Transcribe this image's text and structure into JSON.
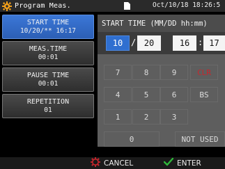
{
  "topbar": {
    "title": "Program Meas.",
    "datetime": "Oct/10/18 18:26:5"
  },
  "menu": {
    "start_time": {
      "label": "START TIME",
      "value": "10/20/** 16:17"
    },
    "meas_time": {
      "label": "MEAS.TIME",
      "value": "00:01"
    },
    "pause_time": {
      "label": "PAUSE TIME",
      "value": "00:01"
    },
    "repetition": {
      "label": "REPETITION",
      "value": "01"
    }
  },
  "panel": {
    "header": "START TIME (MM/DD hh:mm)",
    "fields": {
      "month": "10",
      "day": "20",
      "hour": "16",
      "minute": "17"
    },
    "date_separator": "/",
    "time_separator": ":",
    "keypad": {
      "k7": "7",
      "k8": "8",
      "k9": "9",
      "clr": "CLR",
      "k4": "4",
      "k5": "5",
      "k6": "6",
      "bs": "BS",
      "k1": "1",
      "k2": "2",
      "k3": "3",
      "k0": "0",
      "not_used": "NOT USED"
    }
  },
  "bottom": {
    "cancel": "CANCEL",
    "enter": "ENTER"
  },
  "colors": {
    "accent_blue": "#2f6fd0",
    "cancel_red": "#c8262c",
    "enter_green": "#2fb83a",
    "gear_orange": "#f2a01a"
  }
}
